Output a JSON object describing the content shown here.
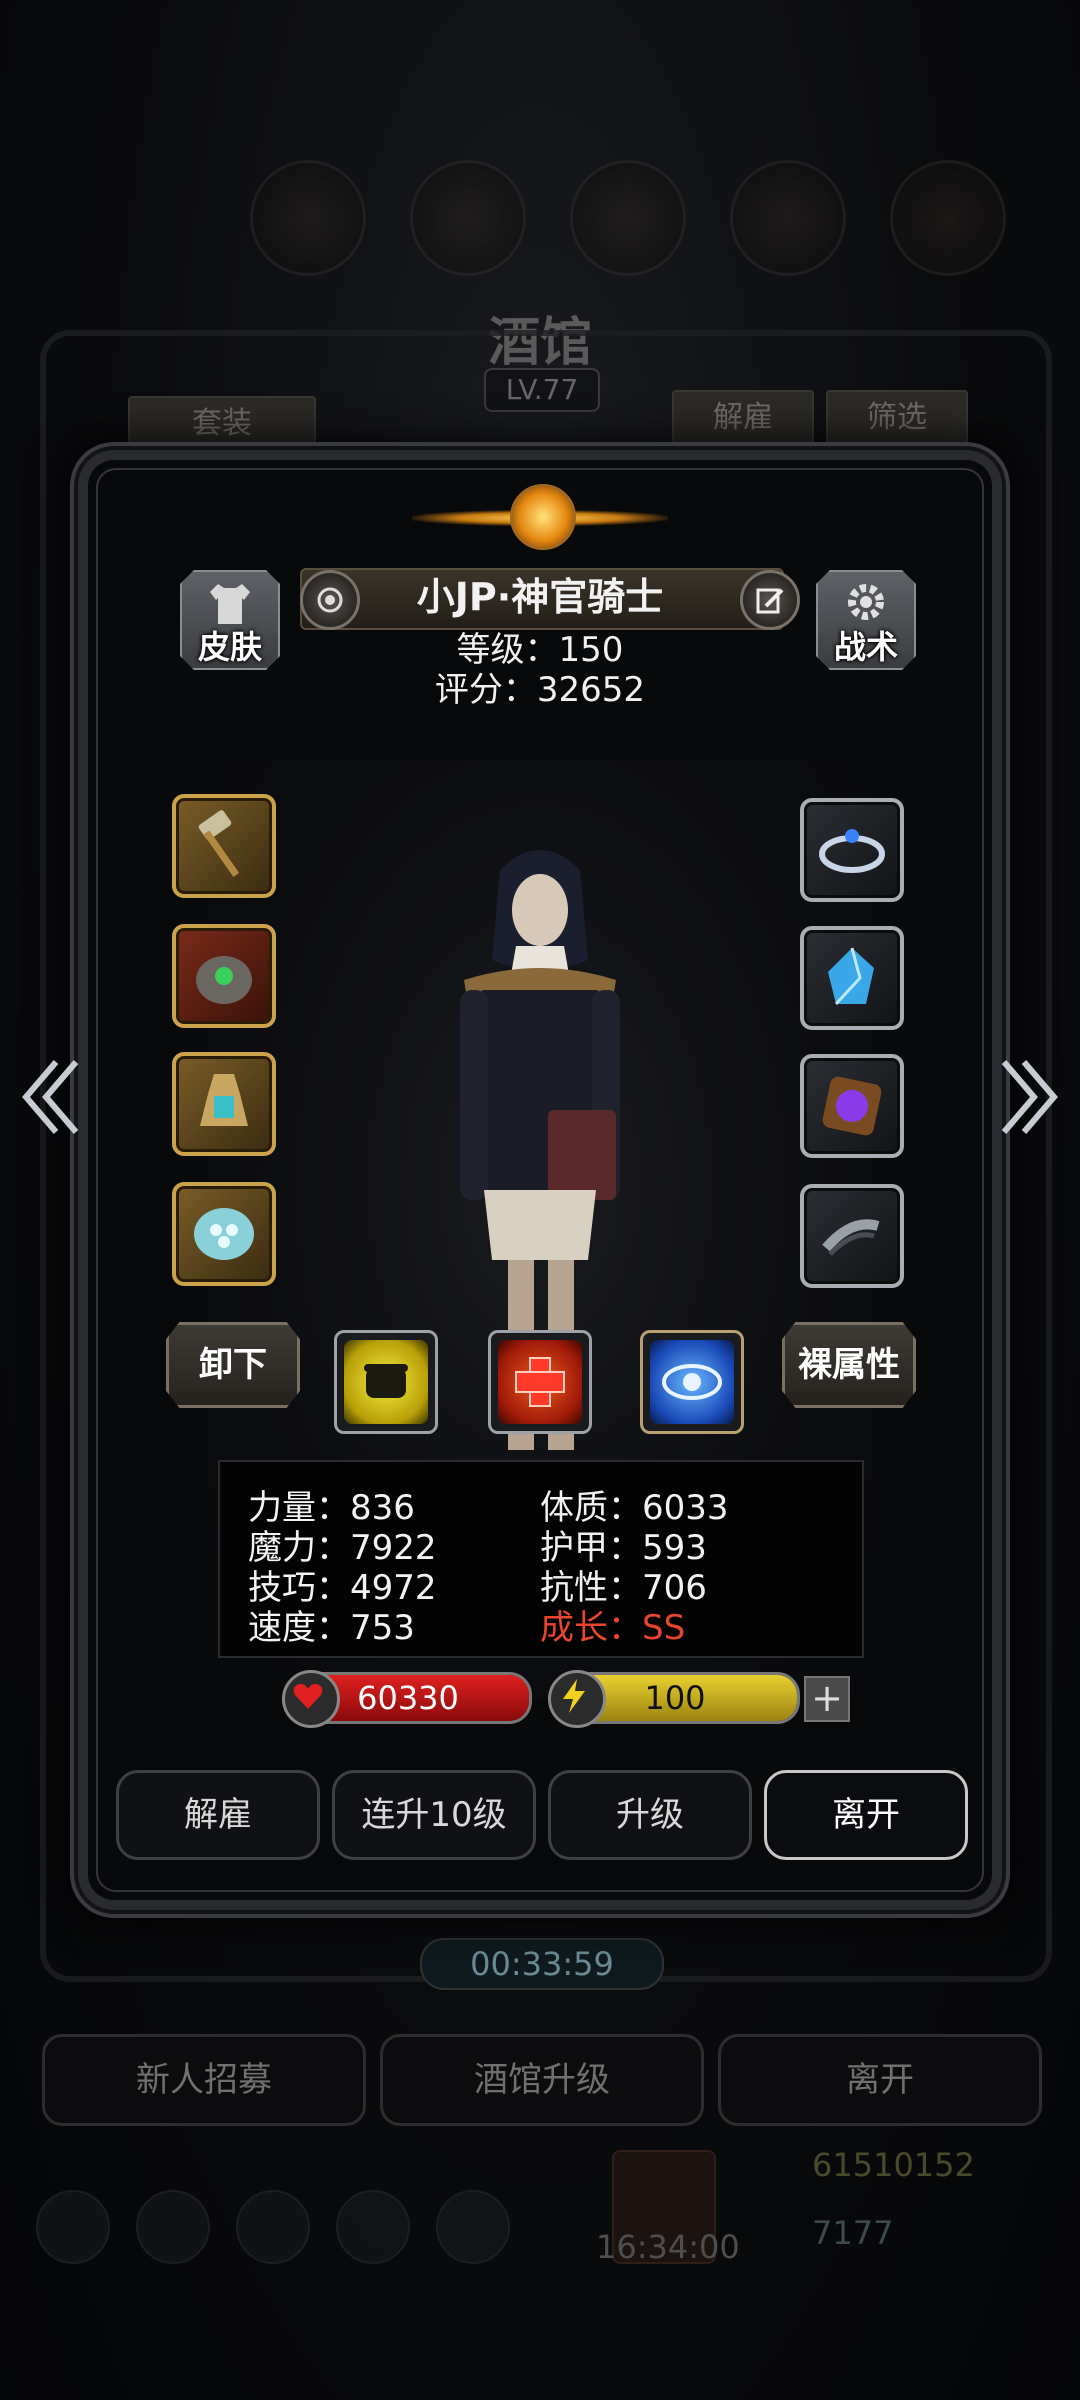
{
  "background": {
    "title": "酒馆",
    "level": "LV.77",
    "buttons": [
      "套装",
      "解雇",
      "筛选"
    ],
    "timer": "00:33:59",
    "bottom_buttons": [
      "新人招募",
      "酒馆升级",
      "离开"
    ],
    "clock": "16:34:00",
    "gold": "61510152",
    "gems": "7177"
  },
  "hero": {
    "name": "小JP·神官骑士",
    "level_text": "等级：150",
    "score_text": "评分：32652"
  },
  "side_buttons": {
    "skin": "皮肤",
    "tactics": "战术"
  },
  "action_buttons": {
    "unequip": "卸下",
    "bare_attr": "裸属性"
  },
  "stats": {
    "strength": "力量：836",
    "magic": "魔力：7922",
    "skill": "技巧：4972",
    "speed": "速度：753",
    "constitution": "体质：6033",
    "armor": "护甲：593",
    "resistance": "抗性：706",
    "growth": "成长：SS"
  },
  "hp": {
    "value": "60330",
    "fill_percent": 100
  },
  "energy": {
    "value": "100",
    "fill_percent": 100
  },
  "plus_label": "+",
  "bottom": [
    "解雇",
    "连升10级",
    "升级",
    "离开"
  ],
  "colors": {
    "growth_red": "#e8442e",
    "hp_red": "#e02020",
    "energy_yellow": "#e8d030",
    "gold_frame": "#c9a24a",
    "silver_frame": "#a8adb3"
  },
  "equipment_icons": {
    "left": [
      "hammer-icon",
      "gem-helmet-icon",
      "potion-amulet-icon",
      "crystal-ring-icon"
    ],
    "right": [
      "tiara-icon",
      "blue-crystal-icon",
      "purple-orb-icon",
      "bracelet-icon"
    ]
  },
  "skill_icons": [
    "fist-icon",
    "red-cross-icon",
    "eye-icon"
  ]
}
